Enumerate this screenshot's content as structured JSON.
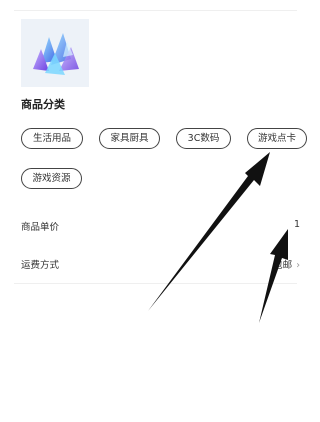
{
  "product": {
    "image_icon": "crystal-icon"
  },
  "category": {
    "title": "商品分类",
    "options": [
      "生活用品",
      "家具厨具",
      "3C数码",
      "游戏点卡",
      "游戏资源"
    ]
  },
  "fields": {
    "unit_price_label": "商品单价",
    "unit_price_value": "1",
    "shipping_label": "运费方式",
    "shipping_value": "包邮"
  }
}
